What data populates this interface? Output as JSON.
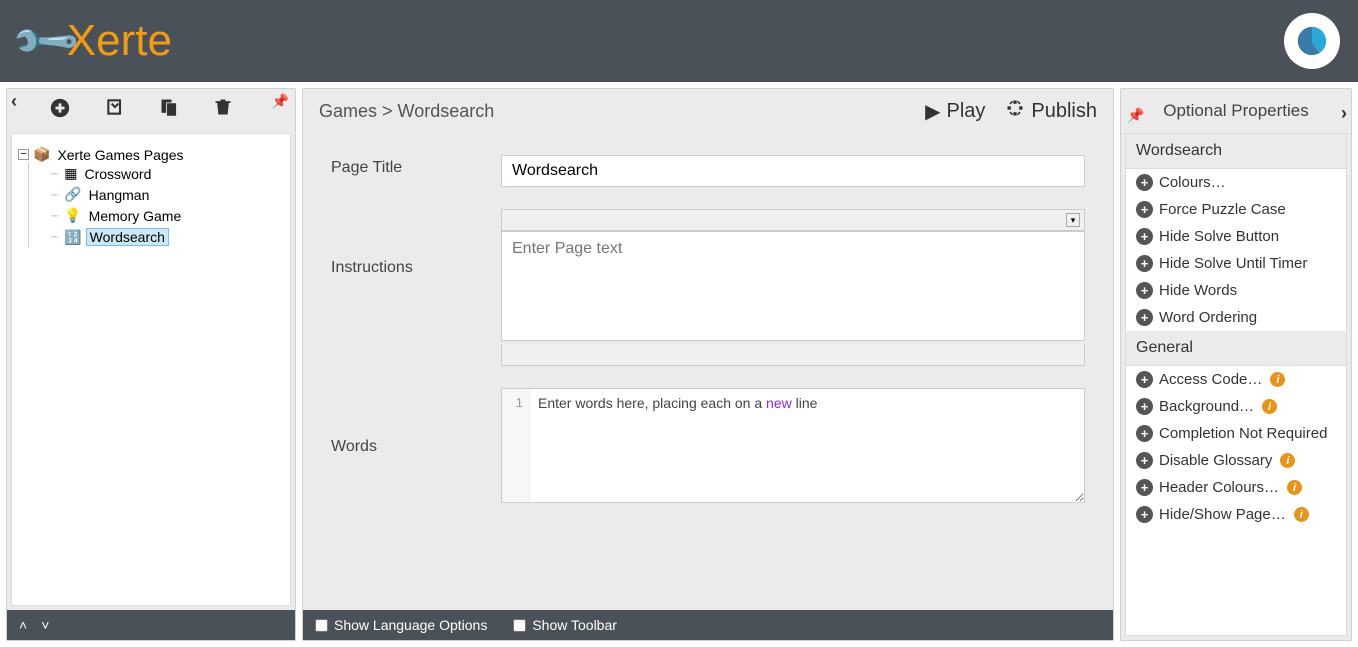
{
  "logo_text": "erte",
  "breadcrumb": "Games > Wordsearch",
  "header_buttons": {
    "play": "Play",
    "publish": "Publish"
  },
  "tree": {
    "root": "Xerte Games Pages",
    "items": [
      "Crossword",
      "Hangman",
      "Memory Game",
      "Wordsearch"
    ]
  },
  "form": {
    "page_title_label": "Page Title",
    "page_title_value": "Wordsearch",
    "instructions_label": "Instructions",
    "instructions_placeholder": "Enter Page text",
    "words_label": "Words",
    "words_prefix": "Enter words here, placing each on a ",
    "words_keyword": "new",
    "words_suffix": " line",
    "gutter_line": "1"
  },
  "bottom": {
    "lang": "Show Language Options",
    "toolbar": "Show Toolbar"
  },
  "right": {
    "title": "Optional Properties",
    "section1": "Wordsearch",
    "items1": [
      "Colours…",
      "Force Puzzle Case",
      "Hide Solve Button",
      "Hide Solve Until Timer",
      "Hide Words",
      "Word Ordering"
    ],
    "section2": "General",
    "items2": [
      {
        "label": "Access Code…",
        "info": true
      },
      {
        "label": "Background…",
        "info": true
      },
      {
        "label": "Completion Not Required",
        "info": false
      },
      {
        "label": "Disable Glossary",
        "info": true
      },
      {
        "label": "Header Colours…",
        "info": true
      },
      {
        "label": "Hide/Show Page…",
        "info": true
      }
    ]
  }
}
